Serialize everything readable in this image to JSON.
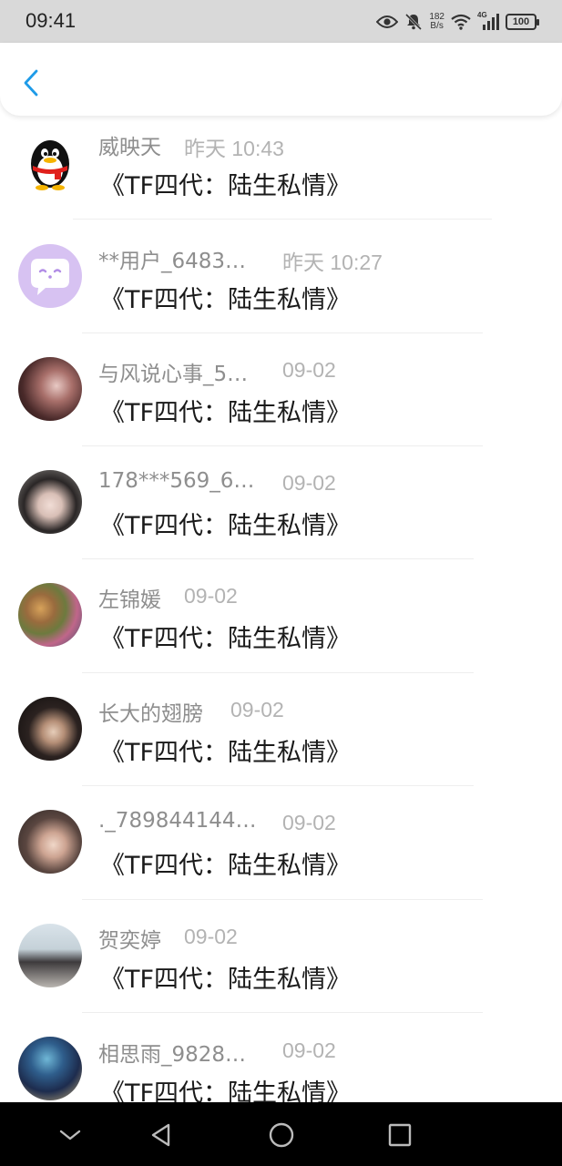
{
  "status_bar": {
    "time": "09:41",
    "net_speed_value": "182",
    "net_speed_unit": "B/s",
    "signal_type": "4G",
    "battery": "100",
    "icons": [
      "eye-icon",
      "mute-icon",
      "wifi-icon",
      "signal-icon",
      "battery-icon"
    ]
  },
  "header": {
    "back_icon": "chevron-left-icon",
    "accent_color": "#1e9be8"
  },
  "list": {
    "items": [
      {
        "name": "威映天",
        "time": "昨天 10:43",
        "text": "《TF四代：陆生私情》",
        "avatar": "qq-penguin-avatar"
      },
      {
        "name": "**用户_6483…",
        "time": "昨天 10:27",
        "text": "《TF四代：陆生私情》",
        "avatar": "chat-bubble-avatar"
      },
      {
        "name": "与风说心事_5…",
        "time": "09-02",
        "text": "《TF四代：陆生私情》",
        "avatar": "photo-avatar"
      },
      {
        "name": "178***569_6…",
        "time": "09-02",
        "text": "《TF四代：陆生私情》",
        "avatar": "photo-avatar"
      },
      {
        "name": "左锦媛",
        "time": "09-02",
        "text": "《TF四代：陆生私情》",
        "avatar": "photo-avatar"
      },
      {
        "name": "长大的翅膀",
        "time": "09-02",
        "text": "《TF四代：陆生私情》",
        "avatar": "photo-avatar"
      },
      {
        "name": "._789844144…",
        "time": "09-02",
        "text": "《TF四代：陆生私情》",
        "avatar": "photo-avatar"
      },
      {
        "name": "贺奕婷",
        "time": "09-02",
        "text": "《TF四代：陆生私情》",
        "avatar": "photo-avatar"
      },
      {
        "name": "相思雨_9828…",
        "time": "09-02",
        "text": "《TF四代：陆生私情》",
        "avatar": "photo-avatar"
      }
    ]
  },
  "nav_bar": {
    "buttons": [
      "collapse-icon",
      "back-triangle-icon",
      "home-circle-icon",
      "recents-square-icon"
    ]
  }
}
